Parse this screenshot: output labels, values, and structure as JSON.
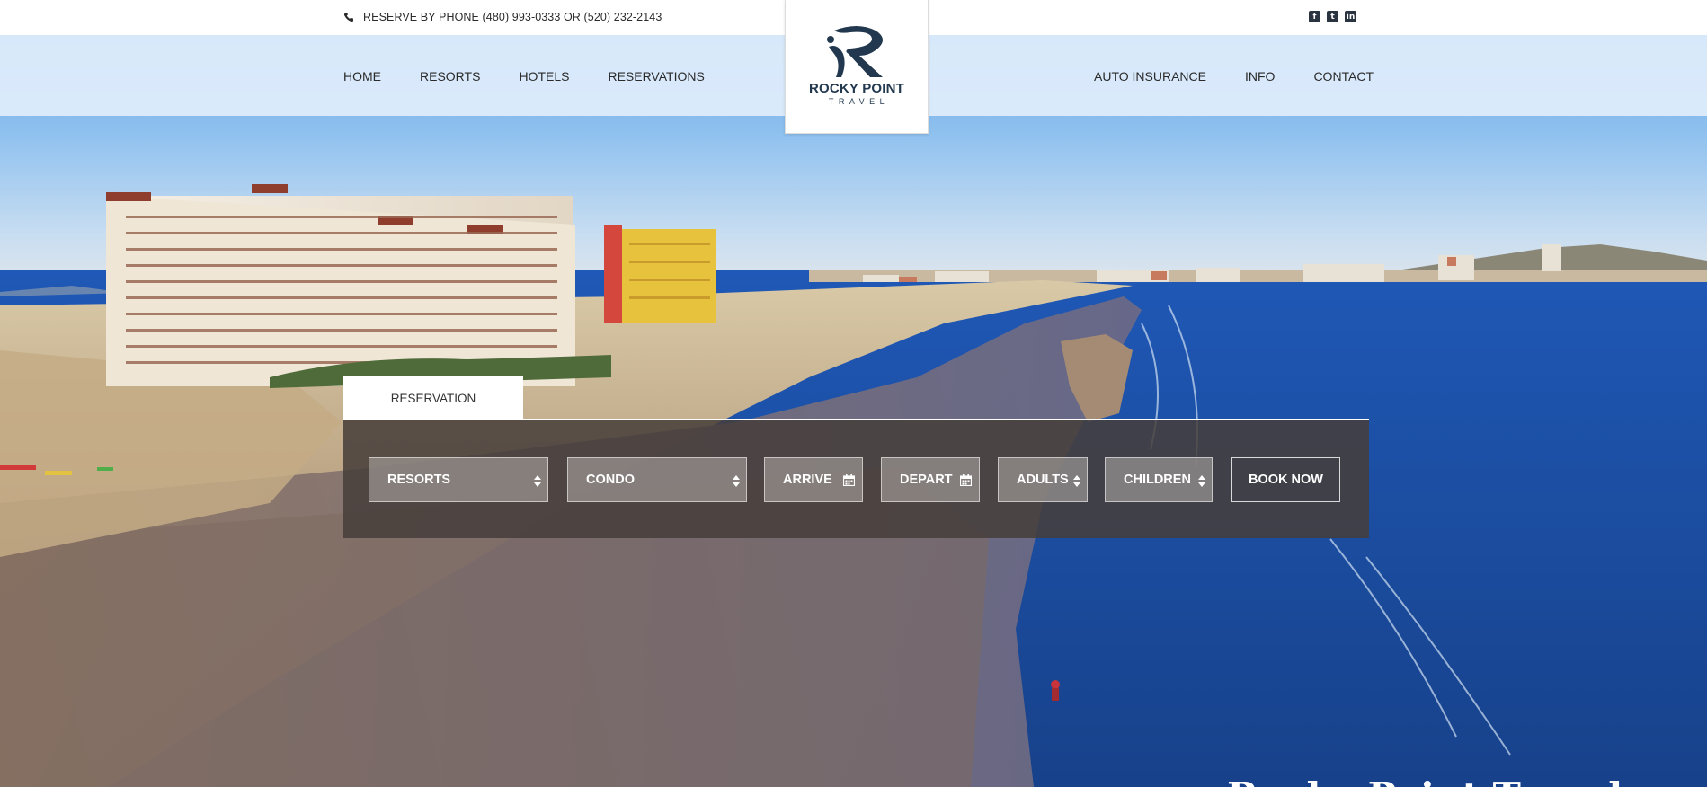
{
  "topbar": {
    "phone_icon": "phone-icon",
    "phone_text": "RESERVE BY PHONE (480) 993-0333 OR (520) 232-2143",
    "socials": [
      {
        "name": "facebook-icon",
        "glyph": "f"
      },
      {
        "name": "twitter-icon",
        "glyph": "t"
      },
      {
        "name": "linkedin-icon",
        "glyph": "in"
      }
    ]
  },
  "nav": {
    "left": [
      "HOME",
      "RESORTS",
      "HOTELS",
      "RESERVATIONS"
    ],
    "right": [
      "AUTO INSURANCE",
      "INFO",
      "CONTACT"
    ]
  },
  "logo": {
    "name": "ROCKY POINT",
    "sub": "TRAVEL",
    "color": "#22384f"
  },
  "reservation": {
    "tab_label": "RESERVATION",
    "resort_select": "RESORTS",
    "unit_select": "CONDO",
    "arrive_field": "ARRIVE",
    "depart_field": "DEPART",
    "adults_select": "ADULTS",
    "children_select": "CHILDREN",
    "book_button": "BOOK NOW"
  },
  "hero": {
    "heading": "Rocky Point Travel"
  }
}
